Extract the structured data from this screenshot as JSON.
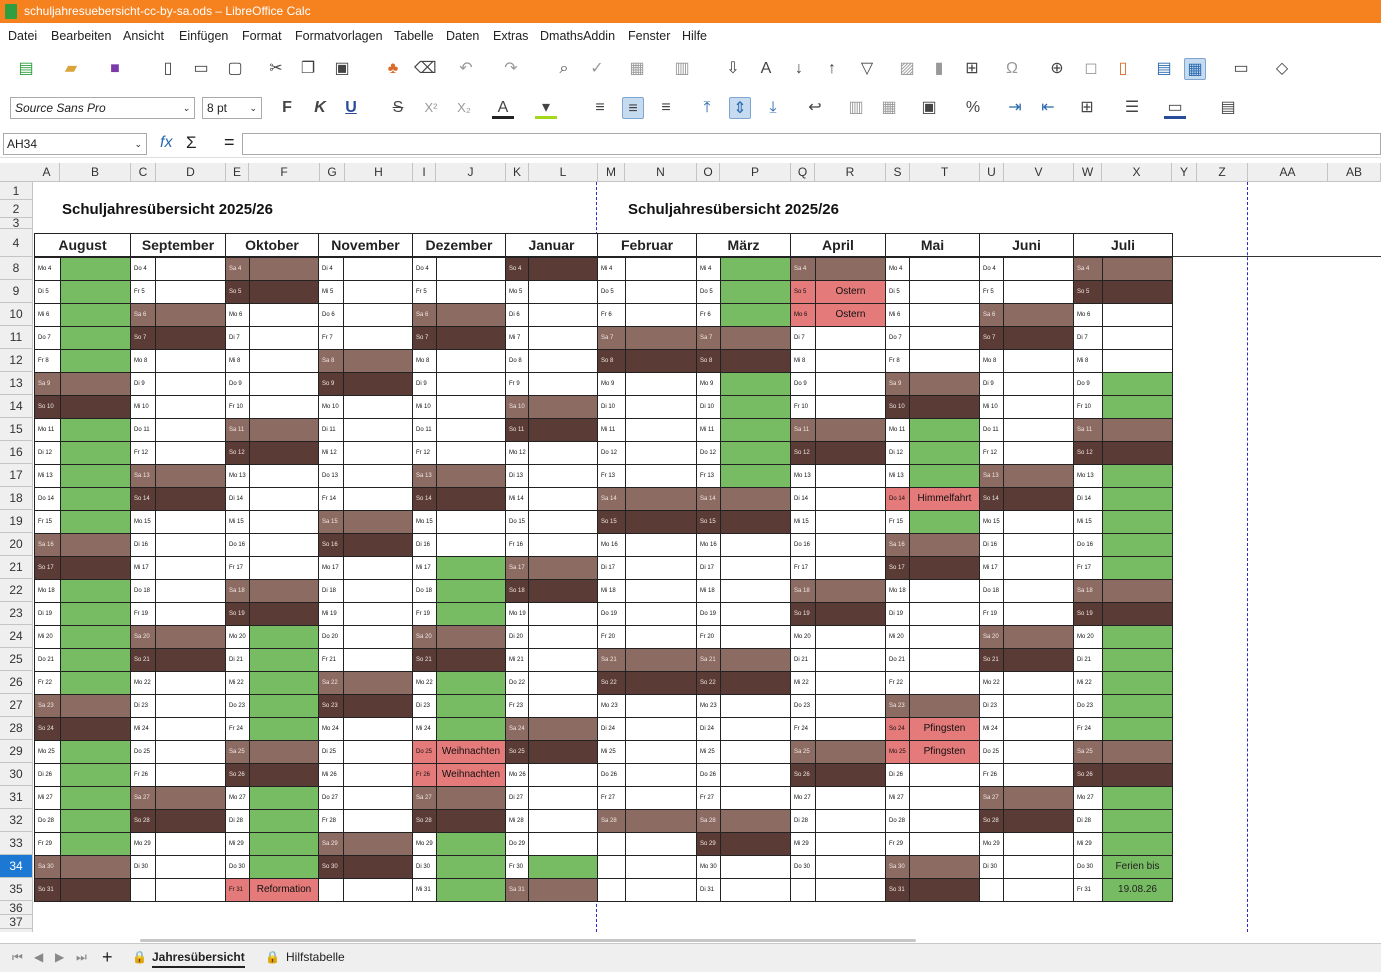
{
  "window": {
    "title": "schuljahresuebersicht-cc-by-sa.ods – LibreOffice Calc",
    "accent": "#f6821f"
  },
  "menu": [
    "Datei",
    "Bearbeiten",
    "Ansicht",
    "Einfügen",
    "Format",
    "Formatvorlagen",
    "Tabelle",
    "Daten",
    "Extras",
    "DmathsAddin",
    "Fenster",
    "Hilfe"
  ],
  "formatbar": {
    "font_name": "Source Sans Pro",
    "font_size": "8 pt",
    "bold": "F",
    "italic": "K",
    "underline": "U",
    "strike": "S",
    "superscript": "X²",
    "subscript": "X₂",
    "percent": "%"
  },
  "formula": {
    "cell_ref": "AH34",
    "fx": "fx",
    "sum": "Σ",
    "equals": "=",
    "content": ""
  },
  "columns": [
    "A",
    "B",
    "C",
    "D",
    "E",
    "F",
    "G",
    "H",
    "I",
    "J",
    "K",
    "L",
    "M",
    "N",
    "O",
    "P",
    "Q",
    "R",
    "S",
    "T",
    "U",
    "V",
    "W",
    "X",
    "Y",
    "Z",
    "AA",
    "AB"
  ],
  "rows": [
    "1",
    "2",
    "3",
    "4",
    "8",
    "9",
    "10",
    "11",
    "12",
    "13",
    "14",
    "15",
    "16",
    "17",
    "18",
    "19",
    "20",
    "21",
    "22",
    "23",
    "24",
    "25",
    "26",
    "27",
    "28",
    "29",
    "30",
    "31",
    "32",
    "33",
    "34",
    "35",
    "36",
    "37"
  ],
  "active_row": "34",
  "titles": [
    "Schuljahresübersicht 2025/26",
    "Schuljahresübersicht 2025/26"
  ],
  "months": [
    {
      "name": "August",
      "days": [
        "Mo 4",
        "Di 5",
        "Mi 6",
        "Do 7",
        "Fr 8",
        "Sa 9",
        "So 10",
        "Mo 11",
        "Di 12",
        "Mi 13",
        "Do 14",
        "Fr 15",
        "Sa 16",
        "So 17",
        "Mo 18",
        "Di 19",
        "Mi 20",
        "Do 21",
        "Fr 22",
        "Sa 23",
        "So 24",
        "Mo 25",
        "Di 26",
        "Mi 27",
        "Do 28",
        "Fr 29",
        "Sa 30",
        "So 31"
      ],
      "info": [
        "G",
        "G",
        "G",
        "G",
        "G",
        "SA",
        "SO",
        "G",
        "G",
        "G",
        "G",
        "G",
        "SA",
        "SO",
        "G",
        "G",
        "G",
        "G",
        "G",
        "SA",
        "SO",
        "G",
        "G",
        "G",
        "G",
        "G",
        "SA",
        "SO"
      ]
    },
    {
      "name": "September",
      "days": [
        "Do 4",
        "Fr 5",
        "Sa 6",
        "So 7",
        "Mo 8",
        "Di 9",
        "Mi 10",
        "Do 11",
        "Fr 12",
        "Sa 13",
        "So 14",
        "Mo 15",
        "Di 16",
        "Mi 17",
        "Do 18",
        "Fr 19",
        "Sa 20",
        "So 21",
        "Mo 22",
        "Di 23",
        "Mi 24",
        "Do 25",
        "Fr 26",
        "Sa 27",
        "So 28",
        "Mo 29",
        "Di 30",
        ""
      ],
      "info": [
        "",
        "",
        "SA",
        "SO",
        "",
        "",
        "",
        "",
        "",
        "SA",
        "SO",
        "",
        "",
        "",
        "",
        "",
        "SA",
        "SO",
        "",
        "",
        "",
        "",
        "",
        "SA",
        "SO",
        "",
        "",
        ""
      ]
    },
    {
      "name": "Oktober",
      "days": [
        "Sa 4",
        "So 5",
        "Mo 6",
        "Di 7",
        "Mi 8",
        "Do 9",
        "Fr 10",
        "Sa 11",
        "So 12",
        "Mo 13",
        "Di 14",
        "Mi 15",
        "Do 16",
        "Fr 17",
        "Sa 18",
        "So 19",
        "Mo 20",
        "Di 21",
        "Mi 22",
        "Do 23",
        "Fr 24",
        "Sa 25",
        "So 26",
        "Mo 27",
        "Di 28",
        "Mi 29",
        "Do 30",
        "Fr 31"
      ],
      "info": [
        "SA",
        "SO",
        "",
        "",
        "",
        "",
        "",
        "SA",
        "SO",
        "",
        "",
        "",
        "",
        "",
        "SA",
        "SO",
        "G",
        "G",
        "G",
        "G",
        "G",
        "SA",
        "SO",
        "G",
        "G",
        "G",
        "G",
        "Reformation"
      ]
    },
    {
      "name": "November",
      "days": [
        "Di 4",
        "Mi 5",
        "Do 6",
        "Fr 7",
        "Sa 8",
        "So 9",
        "Mo 10",
        "Di 11",
        "Mi 12",
        "Do 13",
        "Fr 14",
        "Sa 15",
        "So 16",
        "Mo 17",
        "Di 18",
        "Mi 19",
        "Do 20",
        "Fr 21",
        "Sa 22",
        "So 23",
        "Mo 24",
        "Di 25",
        "Mi 26",
        "Do 27",
        "Fr 28",
        "Sa 29",
        "So 30",
        ""
      ],
      "info": [
        "",
        "",
        "",
        "",
        "SA",
        "SO",
        "",
        "",
        "",
        "",
        "",
        "SA",
        "SO",
        "",
        "",
        "",
        "",
        "",
        "SA",
        "SO",
        "",
        "",
        "",
        "",
        "",
        "SA",
        "SO",
        ""
      ]
    },
    {
      "name": "Dezember",
      "days": [
        "Do 4",
        "Fr 5",
        "Sa 6",
        "So 7",
        "Mo 8",
        "Di 9",
        "Mi 10",
        "Do 11",
        "Fr 12",
        "Sa 13",
        "So 14",
        "Mo 15",
        "Di 16",
        "Mi 17",
        "Do 18",
        "Fr 19",
        "Sa 20",
        "So 21",
        "Mo 22",
        "Di 23",
        "Mi 24",
        "Do 25",
        "Fr 26",
        "Sa 27",
        "So 28",
        "Mo 29",
        "Di 30",
        "Mi 31"
      ],
      "info": [
        "",
        "",
        "SA",
        "SO",
        "",
        "",
        "",
        "",
        "",
        "SA",
        "SO",
        "",
        "",
        "G",
        "G",
        "G",
        "SA",
        "SO",
        "G",
        "G",
        "G",
        "Weihnachten",
        "Weihnachten",
        "SA",
        "SO",
        "G",
        "G",
        "G"
      ]
    },
    {
      "name": "Januar",
      "days": [
        "So 4",
        "Mo 5",
        "Di 6",
        "Mi 7",
        "Do 8",
        "Fr 9",
        "Sa 10",
        "So 11",
        "Mo 12",
        "Di 13",
        "Mi 14",
        "Do 15",
        "Fr 16",
        "Sa 17",
        "So 18",
        "Mo 19",
        "Di 20",
        "Mi 21",
        "Do 22",
        "Fr 23",
        "Sa 24",
        "So 25",
        "Mo 26",
        "Di 27",
        "Mi 28",
        "Do 29",
        "Fr 30",
        "Sa 31"
      ],
      "info": [
        "SO",
        "",
        "",
        "",
        "",
        "",
        "SA",
        "SO",
        "",
        "",
        "",
        "",
        "",
        "SA",
        "SO",
        "",
        "",
        "",
        "",
        "",
        "SA",
        "SO",
        "",
        "",
        "",
        "",
        "G",
        "SA"
      ]
    },
    {
      "name": "Februar",
      "days": [
        "Mi 4",
        "Do 5",
        "Fr 6",
        "Sa 7",
        "So 8",
        "Mo 9",
        "Di 10",
        "Mi 11",
        "Do 12",
        "Fr 13",
        "Sa 14",
        "So 15",
        "Mo 16",
        "Di 17",
        "Mi 18",
        "Do 19",
        "Fr 20",
        "Sa 21",
        "So 22",
        "Mo 23",
        "Di 24",
        "Mi 25",
        "Do 26",
        "Fr 27",
        "Sa 28",
        "",
        "",
        ""
      ],
      "info": [
        "",
        "",
        "",
        "SA",
        "SO",
        "",
        "",
        "",
        "",
        "",
        "SA",
        "SO",
        "",
        "",
        "",
        "",
        "",
        "SA",
        "SO",
        "",
        "",
        "",
        "",
        "",
        "SA",
        "",
        "",
        ""
      ]
    },
    {
      "name": "März",
      "days": [
        "Mi 4",
        "Do 5",
        "Fr 6",
        "Sa 7",
        "So 8",
        "Mo 9",
        "Di 10",
        "Mi 11",
        "Do 12",
        "Fr 13",
        "Sa 14",
        "So 15",
        "Mo 16",
        "Di 17",
        "Mi 18",
        "Do 19",
        "Fr 20",
        "Sa 21",
        "So 22",
        "Mo 23",
        "Di 24",
        "Mi 25",
        "Do 26",
        "Fr 27",
        "Sa 28",
        "So 29",
        "Mo 30",
        "Di 31"
      ],
      "info": [
        "G",
        "G",
        "G",
        "SA",
        "SO",
        "G",
        "G",
        "G",
        "G",
        "G",
        "SA",
        "SO",
        "",
        "",
        "",
        "",
        "",
        "SA",
        "SO",
        "",
        "",
        "",
        "",
        "",
        "SA",
        "SO",
        "",
        ""
      ]
    },
    {
      "name": "April",
      "days": [
        "Sa 4",
        "So 5",
        "Mo 6",
        "Di 7",
        "Mi 8",
        "Do 9",
        "Fr 10",
        "Sa 11",
        "So 12",
        "Mo 13",
        "Di 14",
        "Mi 15",
        "Do 16",
        "Fr 17",
        "Sa 18",
        "So 19",
        "Mo 20",
        "Di 21",
        "Mi 22",
        "Do 23",
        "Fr 24",
        "Sa 25",
        "So 26",
        "Mo 27",
        "Di 28",
        "Mi 29",
        "Do 30",
        ""
      ],
      "info": [
        "SA",
        "Ostern",
        "Ostern",
        "",
        "",
        "",
        "",
        "SA",
        "SO",
        "",
        "",
        "",
        "",
        "",
        "SA",
        "SO",
        "",
        "",
        "",
        "",
        "",
        "SA",
        "SO",
        "",
        "",
        "",
        "",
        ""
      ]
    },
    {
      "name": "Mai",
      "days": [
        "Mo 4",
        "Di 5",
        "Mi 6",
        "Do 7",
        "Fr 8",
        "Sa 9",
        "So 10",
        "Mo 11",
        "Di 12",
        "Mi 13",
        "Do 14",
        "Fr 15",
        "Sa 16",
        "So 17",
        "Mo 18",
        "Di 19",
        "Mi 20",
        "Do 21",
        "Fr 22",
        "Sa 23",
        "So 24",
        "Mo 25",
        "Di 26",
        "Mi 27",
        "Do 28",
        "Fr 29",
        "Sa 30",
        "So 31"
      ],
      "info": [
        "",
        "",
        "",
        "",
        "",
        "SA",
        "SO",
        "G",
        "G",
        "G",
        "Himmelfahrt",
        "G",
        "SA",
        "SO",
        "",
        "",
        "",
        "",
        "",
        "SA",
        "Pfingsten",
        "Pfingsten",
        "",
        "",
        "",
        "",
        "SA",
        "SO"
      ]
    },
    {
      "name": "Juni",
      "days": [
        "Do 4",
        "Fr 5",
        "Sa 6",
        "So 7",
        "Mo 8",
        "Di 9",
        "Mi 10",
        "Do 11",
        "Fr 12",
        "Sa 13",
        "So 14",
        "Mo 15",
        "Di 16",
        "Mi 17",
        "Do 18",
        "Fr 19",
        "Sa 20",
        "So 21",
        "Mo 22",
        "Di 23",
        "Mi 24",
        "Do 25",
        "Fr 26",
        "Sa 27",
        "So 28",
        "Mo 29",
        "Di 30",
        ""
      ],
      "info": [
        "",
        "",
        "SA",
        "SO",
        "",
        "",
        "",
        "",
        "",
        "SA",
        "SO",
        "",
        "",
        "",
        "",
        "",
        "SA",
        "SO",
        "",
        "",
        "",
        "",
        "",
        "SA",
        "SO",
        "",
        "",
        ""
      ]
    },
    {
      "name": "Juli",
      "days": [
        "Sa 4",
        "So 5",
        "Mo 6",
        "Di 7",
        "Mi 8",
        "Do 9",
        "Fr 10",
        "Sa 11",
        "So 12",
        "Mo 13",
        "Di 14",
        "Mi 15",
        "Do 16",
        "Fr 17",
        "Sa 18",
        "So 19",
        "Mo 20",
        "Di 21",
        "Mi 22",
        "Do 23",
        "Fr 24",
        "Sa 25",
        "So 26",
        "Mo 27",
        "Di 28",
        "Mi 29",
        "Do 30",
        "Fr 31"
      ],
      "info": [
        "SA",
        "SO",
        "",
        "",
        "",
        "G",
        "G",
        "SA",
        "SO",
        "G",
        "G",
        "G",
        "G",
        "G",
        "SA",
        "SO",
        "G",
        "G",
        "G",
        "G",
        "G",
        "SA",
        "SO",
        "G",
        "G",
        "G",
        "Ferien bis",
        "19.08.26"
      ]
    }
  ],
  "tabs": {
    "sheet1": "Jahresübersicht",
    "sheet2": "Hilfstabelle"
  },
  "colors": {
    "weekday": "#ffffff",
    "saturday": "#8c6b63",
    "sunday": "#5a3b35",
    "ferien": "#77bc63",
    "feiertag": "#e57a7a",
    "active_row_header": "#1c78d3"
  }
}
